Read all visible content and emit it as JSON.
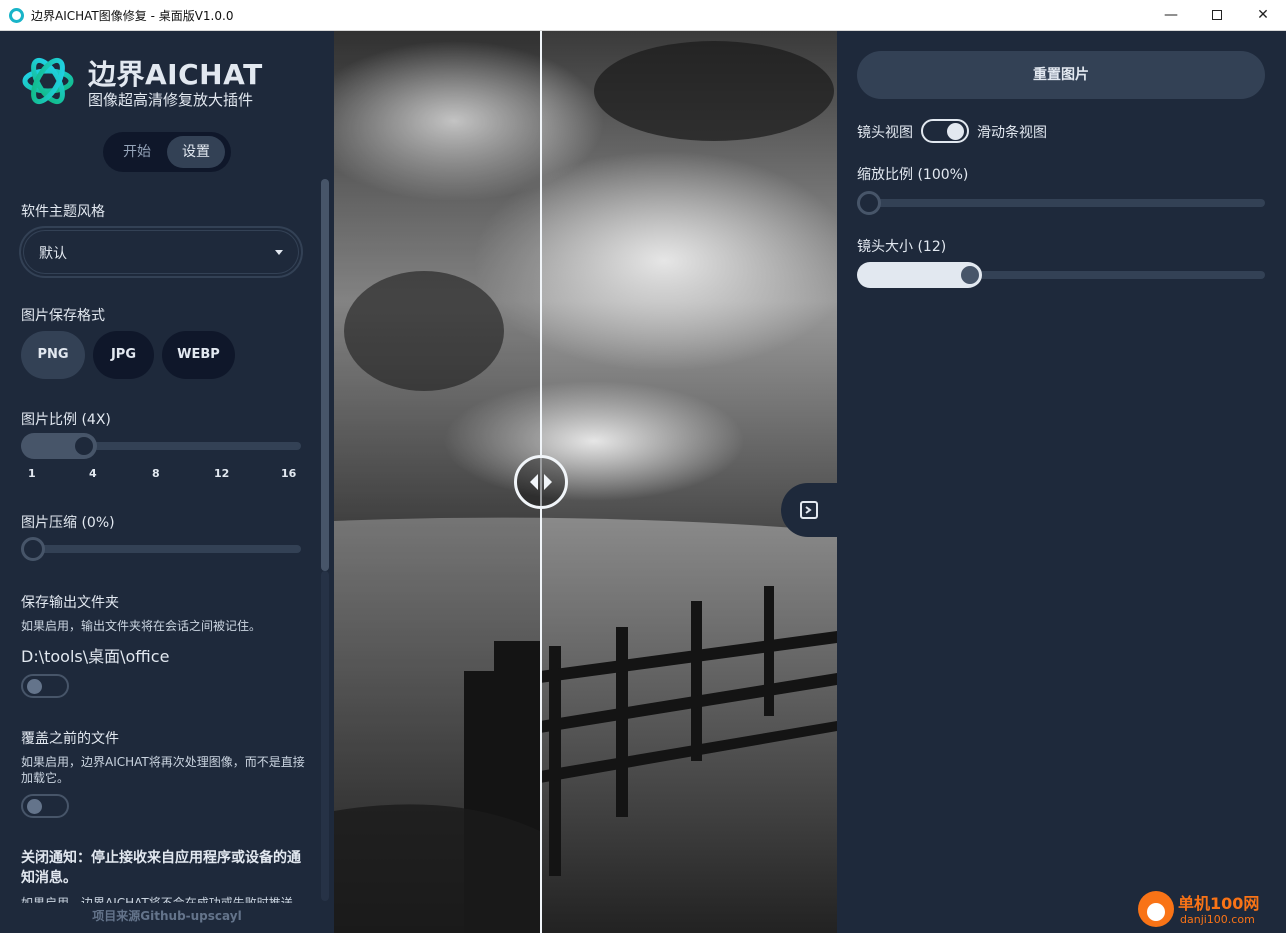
{
  "window": {
    "title": "边界AICHAT图像修复 - 桌面版V1.0.0",
    "min": "—",
    "close": "✕"
  },
  "sidebar": {
    "brand": "边界AICHAT",
    "brand_sub": "图像超高清修复放大插件",
    "tabs": [
      "开始",
      "设置"
    ],
    "active_tab": "设置",
    "theme_label": "软件主题风格",
    "theme_value": "默认",
    "format_label": "图片保存格式",
    "formats": [
      "PNG",
      "JPG",
      "WEBP"
    ],
    "selected_format": "PNG",
    "scale_label": "图片比例 (4X)",
    "scale_value": 4,
    "scale_ticks": [
      "1",
      "4",
      "8",
      "12",
      "16"
    ],
    "compress_label": "图片压缩 (0%)",
    "compress_value": 0,
    "save_folder_label": "保存输出文件夹",
    "save_folder_desc": "如果启用，输出文件夹将在会话之间被记住。",
    "save_folder_path": "D:\\tools\\桌面\\office",
    "save_folder_enabled": false,
    "overwrite_label": "覆盖之前的文件",
    "overwrite_desc": "如果启用，边界AICHAT将再次处理图像，而不是直接加载它。",
    "overwrite_enabled": false,
    "notify_label": "关闭通知：停止接收来自应用程序或设备的通知消息。",
    "notify_desc": "如果启用，边界AICHAT将不会在成功或失败时推送",
    "footer": "项目来源Github-upscayl"
  },
  "viewer": {
    "divider_position": 0.41
  },
  "right_panel": {
    "reset_button": "重置图片",
    "lens_view_label": "镜头视图",
    "slider_view_label": "滑动条视图",
    "view_mode": "滑动条视图",
    "zoom_label": "缩放比例 (100%)",
    "zoom_value": 100,
    "lens_size_label": "镜头大小 (12)",
    "lens_size_value": 12
  },
  "watermark": {
    "line1": "单机100网",
    "line2": "danji100.com"
  },
  "colors": {
    "background": "#1e293b",
    "dark": "#0f172a",
    "surface": "#334155",
    "text": "#e2e8f0",
    "accent_logo": "#19b4c8",
    "watermark": "#f97316"
  }
}
